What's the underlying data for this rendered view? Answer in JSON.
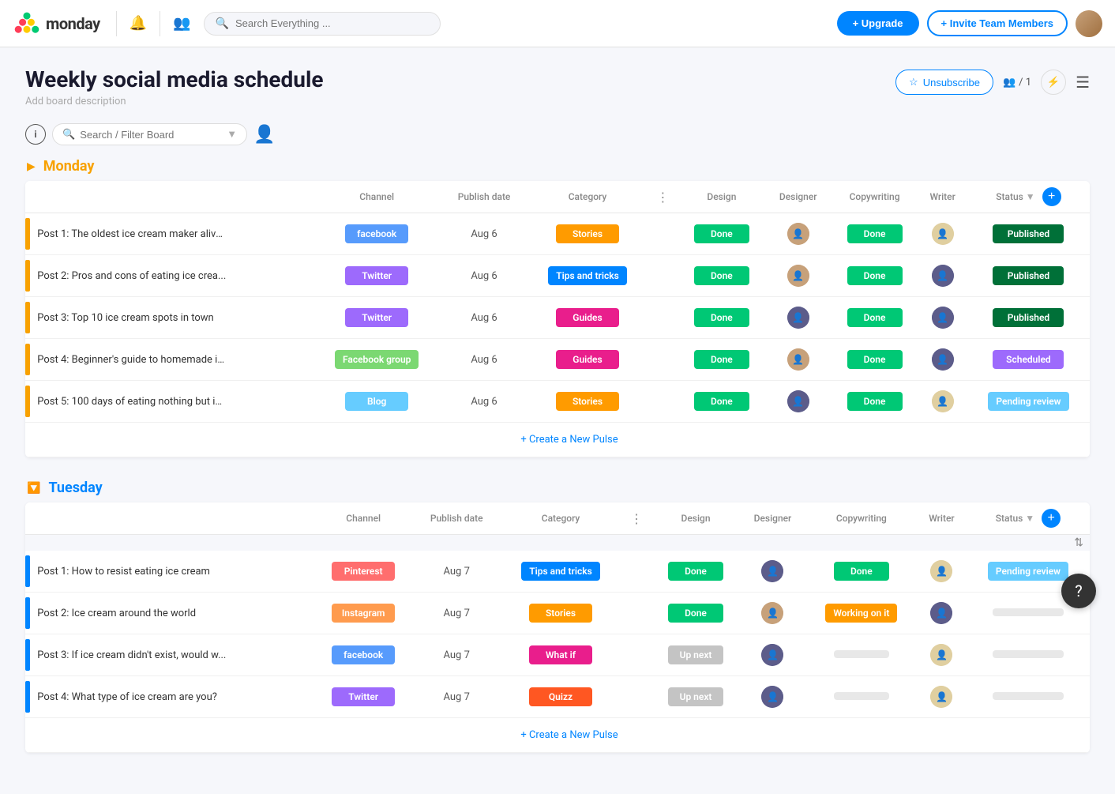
{
  "topnav": {
    "search_placeholder": "Search Everything ...",
    "upgrade_label": "+ Upgrade",
    "invite_label": "+ Invite Team Members"
  },
  "board": {
    "title": "Weekly social media schedule",
    "description": "Add board description",
    "unsubscribe_label": "Unsubscribe",
    "member_count": "/ 1",
    "filter_placeholder": "Search / Filter Board"
  },
  "groups": [
    {
      "id": "monday",
      "label": "Monday",
      "color": "#f8a100",
      "columns": [
        "Channel",
        "Publish date",
        "Category",
        ".",
        "Design",
        "Designer",
        "Copywriting",
        "Writer",
        "Status"
      ],
      "rows": [
        {
          "id": 1,
          "name": "Post 1: The oldest ice cream maker alive...",
          "channel": "facebook",
          "channel_class": "tag-facebook",
          "date": "Aug 6",
          "category": "Stories",
          "category_class": "cat-stories",
          "design": "Done",
          "design_class": "status-done",
          "designer_av": "av1",
          "copywriting": "Done",
          "copy_class": "status-done",
          "writer_av": "av3",
          "status": "Published",
          "status_class": "status-published",
          "indicator_color": "#f8a100"
        },
        {
          "id": 2,
          "name": "Post 2: Pros and cons of eating ice crea...",
          "channel": "Twitter",
          "channel_class": "tag-twitter",
          "date": "Aug 6",
          "category": "Tips and tricks",
          "category_class": "cat-tips",
          "design": "Done",
          "design_class": "status-done",
          "designer_av": "av1",
          "copywriting": "Done",
          "copy_class": "status-done",
          "writer_av": "av2",
          "status": "Published",
          "status_class": "status-published",
          "indicator_color": "#f8a100"
        },
        {
          "id": 3,
          "name": "Post 3: Top 10 ice cream spots in town",
          "channel": "Twitter",
          "channel_class": "tag-twitter",
          "date": "Aug 6",
          "category": "Guides",
          "category_class": "cat-guides",
          "design": "Done",
          "design_class": "status-done",
          "designer_av": "av2",
          "copywriting": "Done",
          "copy_class": "status-done",
          "writer_av": "av2",
          "status": "Published",
          "status_class": "status-published",
          "indicator_color": "#f8a100"
        },
        {
          "id": 4,
          "name": "Post 4: Beginner's guide to homemade ic...",
          "channel": "Facebook group",
          "channel_class": "tag-facebook-group",
          "date": "Aug 6",
          "category": "Guides",
          "category_class": "cat-guides",
          "design": "Done",
          "design_class": "status-done",
          "designer_av": "av1",
          "copywriting": "Done",
          "copy_class": "status-done",
          "writer_av": "av2",
          "status": "Scheduled",
          "status_class": "status-scheduled",
          "indicator_color": "#f8a100"
        },
        {
          "id": 5,
          "name": "Post 5: 100 days of eating nothing but ic...",
          "channel": "Blog",
          "channel_class": "tag-blog",
          "date": "Aug 6",
          "category": "Stories",
          "category_class": "cat-stories",
          "design": "Done",
          "design_class": "status-done",
          "designer_av": "av2",
          "copywriting": "Done",
          "copy_class": "status-done",
          "writer_av": "av3",
          "status": "Pending review",
          "status_class": "status-pending",
          "indicator_color": "#f8a100"
        }
      ],
      "add_pulse": "+ Create a New Pulse"
    },
    {
      "id": "tuesday",
      "label": "Tuesday",
      "color": "#0085ff",
      "columns": [
        "Channel",
        "Publish date",
        "Category",
        ".",
        "Design",
        "Designer",
        "Copywriting",
        "Writer",
        "Status"
      ],
      "rows": [
        {
          "id": 1,
          "name": "Post 1: How to resist eating ice cream",
          "channel": "Pinterest",
          "channel_class": "tag-pinterest",
          "date": "Aug 7",
          "category": "Tips and tricks",
          "category_class": "cat-tips",
          "design": "Done",
          "design_class": "status-done",
          "designer_av": "av2",
          "copywriting": "Done",
          "copy_class": "status-done",
          "writer_av": "av3",
          "status": "Pending review",
          "status_class": "status-pending",
          "indicator_color": "#0085ff"
        },
        {
          "id": 2,
          "name": "Post 2: Ice cream around the world",
          "channel": "Instagram",
          "channel_class": "tag-instagram",
          "date": "Aug 7",
          "category": "Stories",
          "category_class": "cat-stories",
          "design": "Done",
          "design_class": "status-done",
          "designer_av": "av1",
          "copywriting": "Working on it",
          "copy_class": "status-working",
          "writer_av": "av2",
          "status": "",
          "status_class": "status-empty",
          "indicator_color": "#0085ff"
        },
        {
          "id": 3,
          "name": "Post 3: If ice cream didn't exist, would w...",
          "channel": "facebook",
          "channel_class": "tag-facebook",
          "date": "Aug 7",
          "category": "What if",
          "category_class": "cat-whatif",
          "design": "Up next",
          "design_class": "status-upnext",
          "designer_av": "av2",
          "copywriting": "",
          "copy_class": "status-empty",
          "writer_av": "av3",
          "status": "",
          "status_class": "status-empty",
          "indicator_color": "#0085ff"
        },
        {
          "id": 4,
          "name": "Post 4: What type of ice cream are you?",
          "channel": "Twitter",
          "channel_class": "tag-twitter",
          "date": "Aug 7",
          "category": "Quizz",
          "category_class": "cat-quizz",
          "design": "Up next",
          "design_class": "status-upnext",
          "designer_av": "av2",
          "copywriting": "",
          "copy_class": "status-empty",
          "writer_av": "av3",
          "status": "",
          "status_class": "status-empty",
          "indicator_color": "#0085ff"
        }
      ],
      "add_pulse": "+ Create a New Pulse"
    }
  ],
  "help_label": "?"
}
